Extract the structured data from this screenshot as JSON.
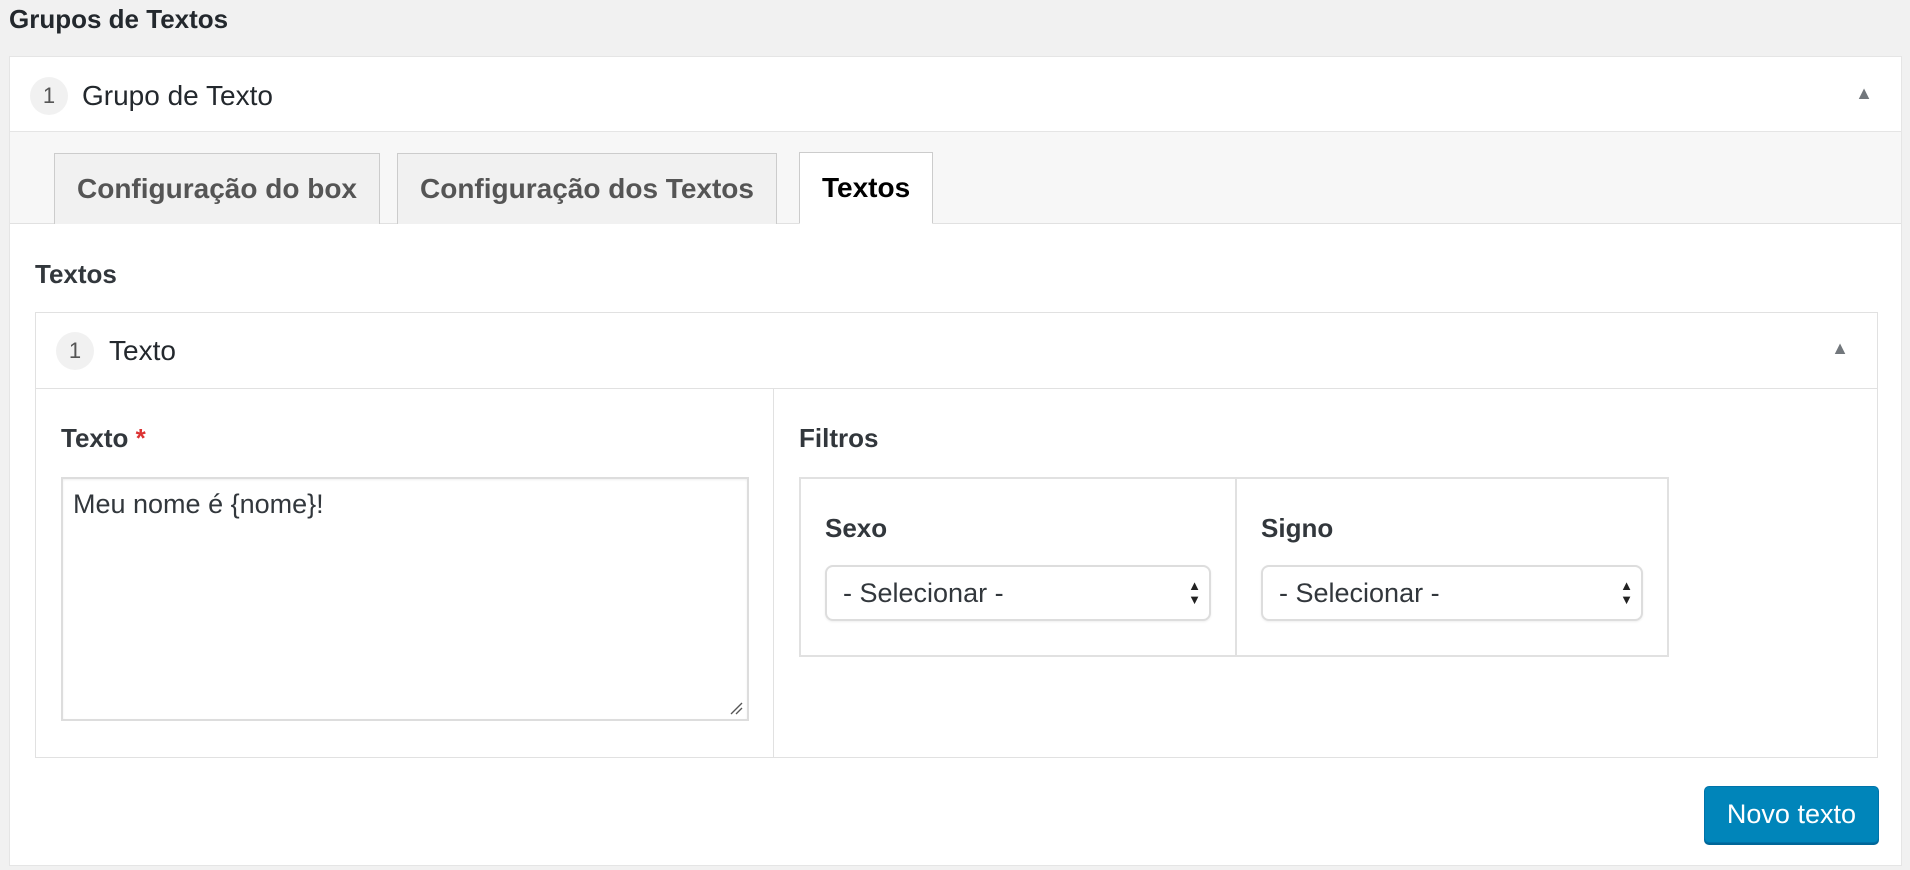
{
  "page": {
    "heading": "Grupos de Textos"
  },
  "group": {
    "number": "1",
    "title": "Grupo de Texto",
    "collapse_glyph": "▲",
    "tabs": [
      {
        "label": "Configuração do box",
        "active": false
      },
      {
        "label": "Configuração dos Textos",
        "active": false
      },
      {
        "label": "Textos",
        "active": true
      }
    ],
    "section_label": "Textos"
  },
  "item": {
    "number": "1",
    "title": "Texto",
    "collapse_glyph": "▲",
    "texto": {
      "label": "Texto",
      "required_mark": "*",
      "value": "Meu nome é {nome}!"
    },
    "filtros": {
      "label": "Filtros",
      "sexo": {
        "label": "Sexo",
        "selected": "- Selecionar -"
      },
      "signo": {
        "label": "Signo",
        "selected": "- Selecionar -"
      }
    }
  },
  "actions": {
    "new_text_button": "Novo texto"
  },
  "colors": {
    "primary_button": "#0085ba",
    "required": "#dc3232"
  }
}
